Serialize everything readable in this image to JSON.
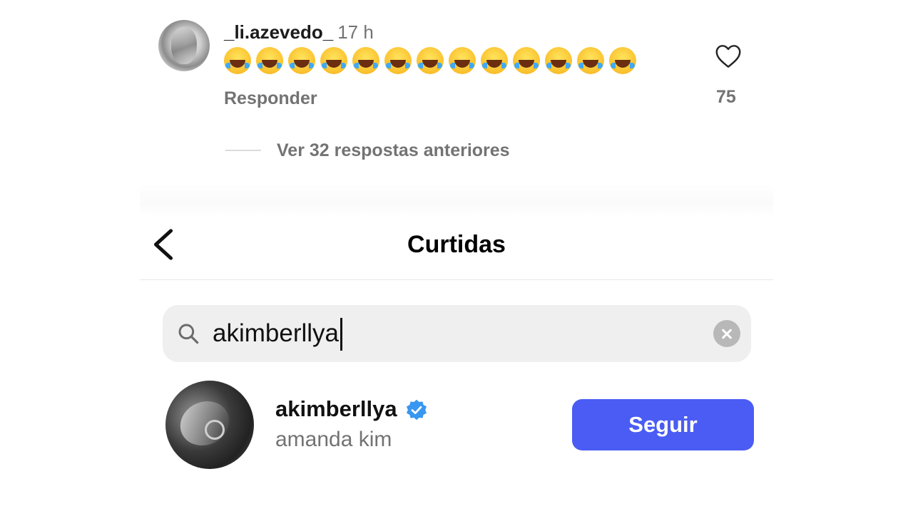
{
  "comment": {
    "username": "_li.azevedo_",
    "time": "17 h",
    "emoji_count": 13,
    "emoji_name": "face-with-tears-of-joy",
    "reply_label": "Responder",
    "like_count": "75",
    "like_icon": "heart-outline-icon"
  },
  "view_replies": {
    "label": "Ver 32 respostas anteriores"
  },
  "likes_sheet": {
    "title": "Curtidas",
    "back_icon": "chevron-left-icon",
    "search": {
      "value": "akimberllya",
      "icon": "search-icon",
      "clear_icon": "clear-icon"
    },
    "results": [
      {
        "username": "akimberllya",
        "verified": true,
        "full_name": "amanda kim",
        "action_label": "Seguir"
      }
    ]
  },
  "colors": {
    "accent": "#4a5cf3",
    "verified": "#3897f0",
    "secondary_text": "#737373",
    "search_bg": "#efefef"
  }
}
